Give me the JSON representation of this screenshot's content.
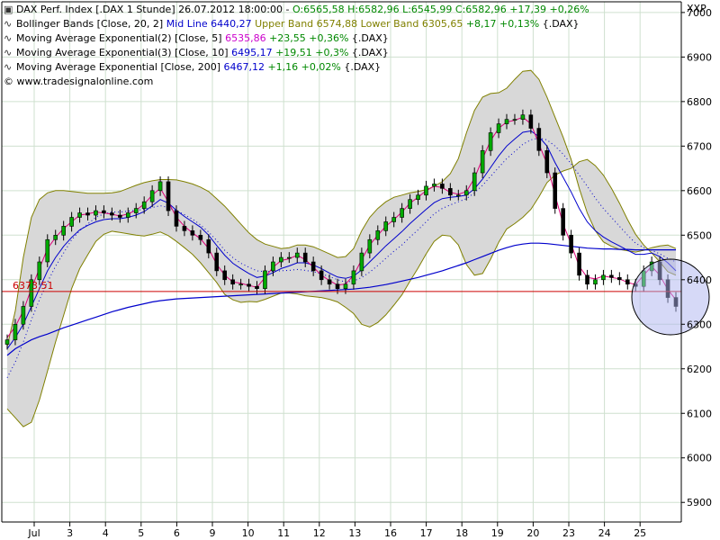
{
  "legend": {
    "line1": {
      "title": "DAX Perf. Index [.DAX  1 Stunde] 26.07.2012 18:00:00 - ",
      "ohlc": "O:6565,58 H:6582,96 L:6545,99",
      "close": "C:6582,96 +17,39 +0,26%"
    },
    "line2": {
      "prefix": "Bollinger Bands [Close, 20, 2] ",
      "mid": "Mid Line 6440,27 ",
      "upper": "Upper Band 6574,88 ",
      "lower": "Lower Band 6305,65 ",
      "change": "+8,17 +0,13%",
      "suffix": " {.DAX}"
    },
    "line3": {
      "prefix": "Moving Average Exponential(2) [Close, 5] ",
      "value": "6535,86 ",
      "change": "+23,55 +0,36%",
      "suffix": " {.DAX}"
    },
    "line4": {
      "prefix": "Moving Average Exponential(3) [Close, 10] ",
      "value": "6495,17 ",
      "change": "+19,51 +0,3%",
      "suffix": " {.DAX}"
    },
    "line5": {
      "prefix": "Moving Average Exponential [Close, 200] ",
      "value": "6467,12 ",
      "change": "+1,16 +0,02%",
      "suffix": " {.DAX}"
    },
    "line6": "© www.tradesignalonline.com"
  },
  "icons": {
    "chart_icon": "candlestick-chart-icon",
    "indicator_icon": "line-indicator-icon"
  },
  "colors": {
    "candle_up": "#00aa00",
    "candle_down": "#000000",
    "band_fill": "#d8d8d8",
    "band_line": "#808000",
    "ema5": "#dd0077",
    "ema10": "#0000cc",
    "ema200": "#0000cc",
    "midline": "#0000cc",
    "hline": "#cc0000",
    "grid": "#cfe0cf"
  },
  "chart_data": {
    "type": "line",
    "title": "DAX Perf. Index [.DAX  1 Stunde]",
    "currency_label": "XXP",
    "y_axis": {
      "ticks": [
        5900,
        6000,
        6100,
        6200,
        6300,
        6400,
        6500,
        6600,
        6700,
        6800,
        6900,
        7000
      ],
      "ylim": [
        5856,
        7024
      ]
    },
    "x_axis": {
      "labels": [
        "Jul",
        "3",
        "4",
        "5",
        "6",
        "9",
        "10",
        "11",
        "12",
        "13",
        "16",
        "17",
        "18",
        "19",
        "20",
        "23",
        "24",
        "25"
      ]
    },
    "horizontal_line": {
      "value": 6373.51,
      "label": "6373,51"
    },
    "series": [
      {
        "name": "Close",
        "values": [
          6265,
          6300,
          6340,
          6400,
          6440,
          6490,
          6500,
          6520,
          6540,
          6550,
          6545,
          6555,
          6550,
          6545,
          6540,
          6550,
          6560,
          6575,
          6600,
          6620,
          6555,
          6520,
          6510,
          6500,
          6490,
          6460,
          6420,
          6400,
          6390,
          6390,
          6385,
          6380,
          6420,
          6440,
          6450,
          6450,
          6460,
          6440,
          6420,
          6400,
          6390,
          6380,
          6390,
          6420,
          6460,
          6490,
          6510,
          6530,
          6540,
          6560,
          6580,
          6590,
          6610,
          6615,
          6605,
          6590,
          6590,
          6600,
          6640,
          6690,
          6730,
          6750,
          6760,
          6760,
          6770,
          6740,
          6690,
          6640,
          6560,
          6500,
          6460,
          6410,
          6390,
          6400,
          6410,
          6405,
          6400,
          6390,
          6385,
          6420,
          6440,
          6400,
          6360,
          6340
        ]
      },
      {
        "name": "Moving Average Exponential(2) [Close, 5]",
        "values": [
          6270,
          6295,
          6330,
          6380,
          6425,
          6470,
          6495,
          6515,
          6530,
          6545,
          6548,
          6552,
          6550,
          6547,
          6543,
          6548,
          6556,
          6570,
          6590,
          6605,
          6575,
          6540,
          6520,
          6505,
          6492,
          6470,
          6435,
          6410,
          6395,
          6392,
          6387,
          6383,
          6405,
          6428,
          6443,
          6447,
          6455,
          6445,
          6428,
          6410,
          6398,
          6388,
          6390,
          6410,
          6445,
          6478,
          6500,
          6520,
          6535,
          6552,
          6572,
          6585,
          6600,
          6610,
          6607,
          6596,
          6592,
          6598,
          6628,
          6672,
          6712,
          6740,
          6754,
          6758,
          6765,
          6750,
          6705,
          6660,
          6590,
          6525,
          6480,
          6430,
          6405,
          6402,
          6408,
          6405,
          6402,
          6394,
          6389,
          6410,
          6430,
          6410,
          6378,
          6355
        ]
      },
      {
        "name": "Moving Average Exponential(3) [Close, 10]",
        "values": [
          6245,
          6270,
          6300,
          6340,
          6380,
          6420,
          6450,
          6475,
          6495,
          6512,
          6522,
          6530,
          6535,
          6537,
          6537,
          6540,
          6545,
          6553,
          6566,
          6580,
          6572,
          6556,
          6542,
          6530,
          6518,
          6500,
          6477,
          6455,
          6437,
          6425,
          6414,
          6405,
          6408,
          6416,
          6425,
          6431,
          6438,
          6438,
          6433,
          6425,
          6415,
          6406,
          6403,
          6408,
          6422,
          6440,
          6458,
          6476,
          6492,
          6508,
          6526,
          6542,
          6558,
          6573,
          6582,
          6585,
          6587,
          6590,
          6604,
          6626,
          6652,
          6678,
          6700,
          6716,
          6731,
          6734,
          6721,
          6700,
          6663,
          6630,
          6597,
          6560,
          6530,
          6510,
          6496,
          6485,
          6476,
          6466,
          6457,
          6457,
          6460,
          6452,
          6438,
          6420
        ]
      },
      {
        "name": "Bollinger Bands Mid Line",
        "values": [
          6180,
          6215,
          6260,
          6310,
          6355,
          6395,
          6430,
          6460,
          6490,
          6510,
          6525,
          6540,
          6548,
          6552,
          6552,
          6554,
          6556,
          6558,
          6562,
          6566,
          6562,
          6555,
          6546,
          6536,
          6523,
          6507,
          6488,
          6466,
          6450,
          6437,
          6428,
          6420,
          6418,
          6419,
          6420,
          6421,
          6423,
          6421,
          6418,
          6413,
          6407,
          6400,
          6395,
          6397,
          6405,
          6417,
          6432,
          6448,
          6464,
          6478,
          6496,
          6512,
          6530,
          6548,
          6560,
          6568,
          6575,
          6582,
          6595,
          6612,
          6632,
          6652,
          6672,
          6688,
          6704,
          6714,
          6718,
          6714,
          6700,
          6682,
          6660,
          6635,
          6610,
          6583,
          6560,
          6540,
          6520,
          6500,
          6482,
          6472,
          6466,
          6458,
          6448,
          6440
        ]
      },
      {
        "name": "Bollinger Bands Upper Band",
        "values": [
          6250,
          6330,
          6450,
          6540,
          6580,
          6595,
          6600,
          6600,
          6598,
          6596,
          6594,
          6594,
          6594,
          6595,
          6598,
          6605,
          6612,
          6618,
          6622,
          6625,
          6625,
          6624,
          6620,
          6615,
          6608,
          6598,
          6582,
          6565,
          6545,
          6525,
          6505,
          6490,
          6480,
          6475,
          6470,
          6472,
          6478,
          6478,
          6474,
          6466,
          6458,
          6450,
          6452,
          6470,
          6510,
          6540,
          6560,
          6575,
          6585,
          6590,
          6595,
          6598,
          6602,
          6610,
          6620,
          6638,
          6672,
          6730,
          6780,
          6810,
          6818,
          6820,
          6830,
          6850,
          6868,
          6870,
          6850,
          6810,
          6765,
          6720,
          6670,
          6605,
          6550,
          6510,
          6485,
          6475,
          6468,
          6465,
          6462,
          6466,
          6472,
          6476,
          6478,
          6470
        ]
      },
      {
        "name": "Bollinger Bands Lower Band",
        "values": [
          6110,
          6090,
          6070,
          6080,
          6130,
          6195,
          6260,
          6320,
          6380,
          6425,
          6456,
          6486,
          6502,
          6509,
          6506,
          6503,
          6500,
          6498,
          6502,
          6507,
          6499,
          6486,
          6472,
          6457,
          6438,
          6416,
          6394,
          6367,
          6355,
          6349,
          6351,
          6350,
          6356,
          6363,
          6370,
          6370,
          6368,
          6364,
          6362,
          6360,
          6356,
          6350,
          6338,
          6324,
          6300,
          6294,
          6304,
          6321,
          6343,
          6366,
          6397,
          6426,
          6458,
          6486,
          6500,
          6498,
          6478,
          6434,
          6410,
          6414,
          6446,
          6484,
          6514,
          6526,
          6540,
          6558,
          6586,
          6618,
          6635,
          6644,
          6650,
          6665,
          6670,
          6656,
          6635,
          6605,
          6572,
          6535,
          6502,
          6478,
          6460,
          6440,
          6418,
          6410
        ]
      },
      {
        "name": "Moving Average Exponential [Close, 200]",
        "values": [
          6230,
          6245,
          6255,
          6265,
          6272,
          6278,
          6285,
          6292,
          6298,
          6304,
          6310,
          6316,
          6322,
          6328,
          6333,
          6338,
          6342,
          6346,
          6350,
          6353,
          6355,
          6357,
          6358,
          6359,
          6360,
          6361,
          6362,
          6363,
          6364,
          6365,
          6366,
          6367,
          6368,
          6369,
          6370,
          6371,
          6372,
          6373,
          6374,
          6375,
          6376,
          6377,
          6378,
          6379,
          6381,
          6383,
          6386,
          6389,
          6393,
          6397,
          6401,
          6405,
          6410,
          6415,
          6420,
          6426,
          6432,
          6438,
          6445,
          6452,
          6459,
          6466,
          6472,
          6477,
          6480,
          6482,
          6482,
          6481,
          6479,
          6477,
          6475,
          6473,
          6471,
          6470,
          6469,
          6469,
          6468,
          6468,
          6467,
          6467,
          6467,
          6467,
          6467,
          6467
        ]
      }
    ]
  }
}
